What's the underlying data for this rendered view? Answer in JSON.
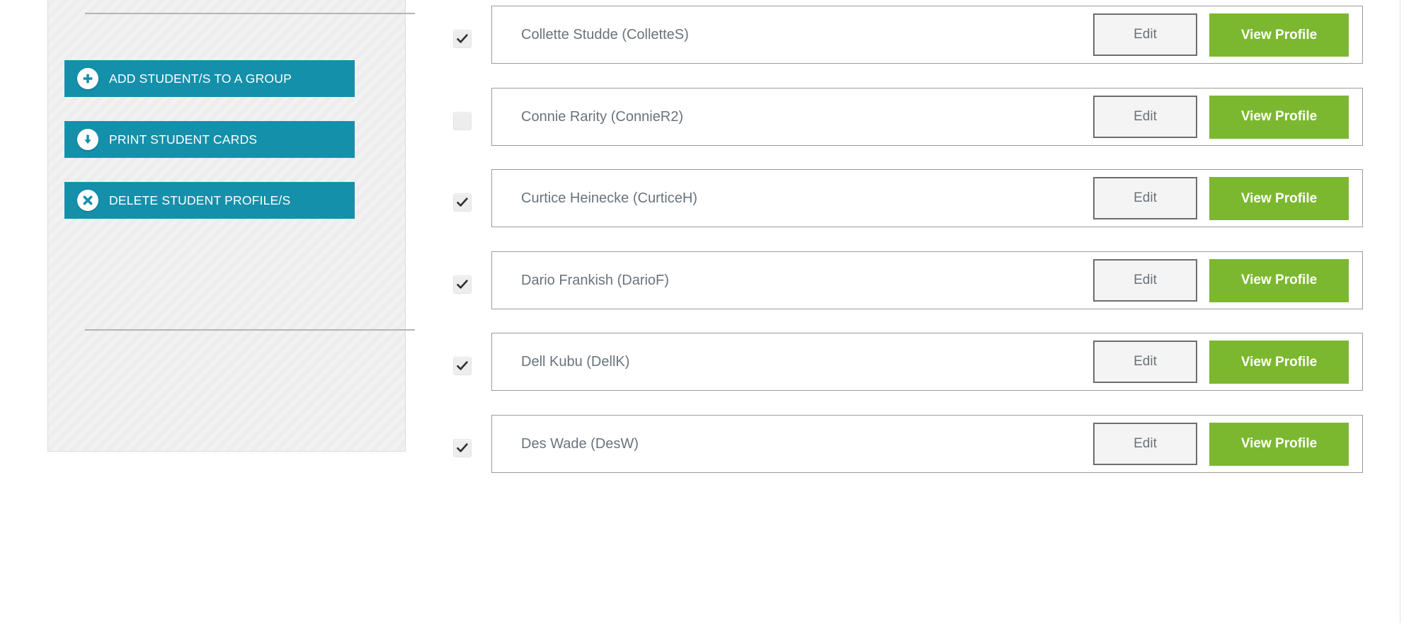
{
  "colors": {
    "teal": "#1590ab",
    "green": "#7cb82f",
    "text_gray": "#6a737b",
    "border_gray": "#9b9b9b",
    "panel_gray": "#f2f2f2"
  },
  "sidebar": {
    "actions": [
      {
        "label": "ADD STUDENT/S TO A GROUP",
        "icon": "plus-circle-icon"
      },
      {
        "label": "PRINT STUDENT CARDS",
        "icon": "download-circle-icon"
      },
      {
        "label": "DELETE STUDENT PROFILE/S",
        "icon": "close-circle-icon"
      }
    ]
  },
  "student_list": {
    "edit_label": "Edit",
    "view_profile_label": "View Profile",
    "rows": [
      {
        "name": "Collette Studde (ColletteS)",
        "checked": true
      },
      {
        "name": "Connie Rarity (ConnieR2)",
        "checked": false
      },
      {
        "name": "Curtice Heinecke (CurticeH)",
        "checked": true
      },
      {
        "name": "Dario Frankish (DarioF)",
        "checked": true
      },
      {
        "name": "Dell Kubu (DellK)",
        "checked": true
      },
      {
        "name": "Des Wade (DesW)",
        "checked": true
      }
    ]
  }
}
